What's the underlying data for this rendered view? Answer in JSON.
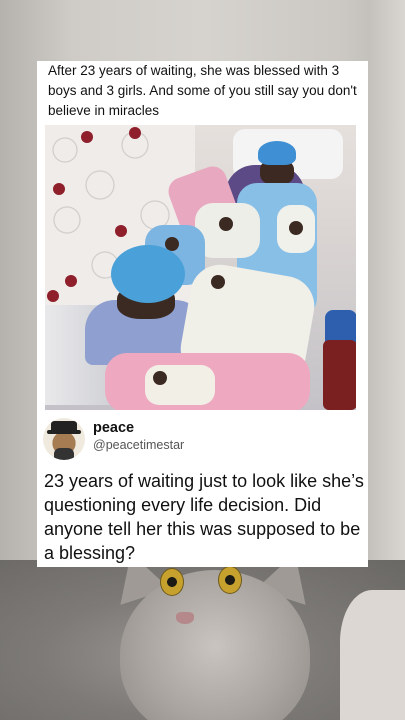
{
  "post": {
    "caption": "After 23 years of waiting, she was blessed with 3 boys and 3 girls. And some of you still say you don't believe in miracles"
  },
  "reply": {
    "display_name": "peace",
    "handle": "@peacetimestar",
    "text": "23 years of waiting just to look like she’s questioning every life decision. Did anyone tell her this was supposed to be a blessing?"
  },
  "colors": {
    "card_background": "#ffffff",
    "text_primary": "#111111",
    "text_secondary": "#555555"
  }
}
